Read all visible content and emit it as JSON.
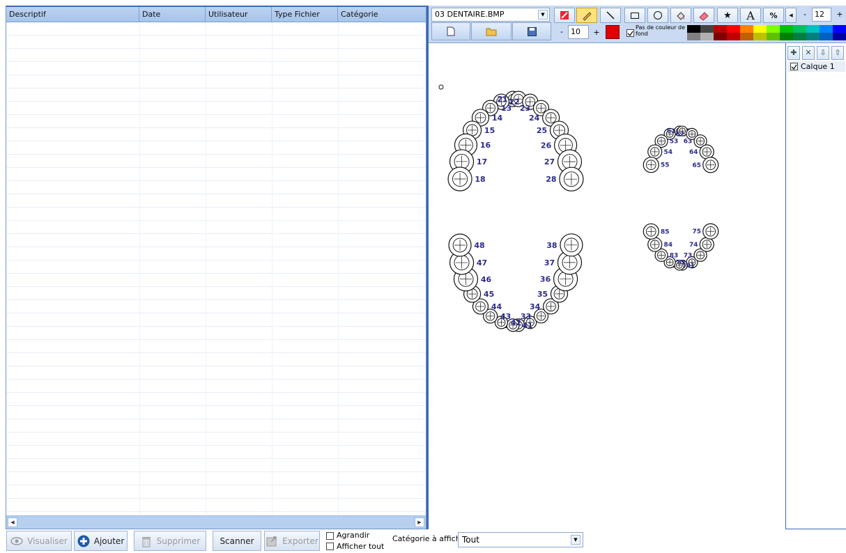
{
  "table": {
    "columns": [
      "Descriptif",
      "Date",
      "Utilisateur",
      "Type Fichier",
      "Catégorie"
    ],
    "rows": []
  },
  "bottom_toolbar": {
    "visualiser": "Visualiser",
    "ajouter": "Ajouter",
    "supprimer": "Supprimer",
    "scanner": "Scanner",
    "exporter": "Exporter",
    "agrandir": "Agrandir",
    "afficher_tout": "Afficher tout",
    "categorie_label": "Catégorie à afficher:",
    "categorie_value": "Tout"
  },
  "editor": {
    "file_name": "03 DENTAIRE.BMP",
    "pen_size": "10",
    "font_size": "12",
    "no_fill_label": "Pas de couleur de fond",
    "current_color": "#e00000",
    "palette": [
      "#000000",
      "#444444",
      "#c00000",
      "#ff0000",
      "#ff8000",
      "#ffff00",
      "#80ff00",
      "#00c000",
      "#00c060",
      "#00c0c0",
      "#0080ff",
      "#0000ff",
      "#808080",
      "#b0b0b0",
      "#800000",
      "#c00000",
      "#c06000",
      "#c0c000",
      "#60c000",
      "#008000",
      "#008040",
      "#008080",
      "#0060c0",
      "#0000a0"
    ],
    "tools": [
      "eraser-fill-icon",
      "pencil-icon",
      "line-icon",
      "rectangle-icon",
      "ellipse-icon",
      "fill-bucket-icon",
      "eraser-icon",
      "star-icon",
      "text-icon",
      "percent-icon"
    ],
    "layer": "Calque 1"
  },
  "chart_data": {
    "type": "table",
    "dental_chart": {
      "permanent_upper": [
        "11",
        "12",
        "13",
        "14",
        "15",
        "16",
        "17",
        "18",
        "21",
        "22",
        "23",
        "24",
        "25",
        "26",
        "27",
        "28"
      ],
      "permanent_lower": [
        "31",
        "32",
        "33",
        "34",
        "35",
        "36",
        "37",
        "38",
        "41",
        "42",
        "43",
        "44",
        "45",
        "46",
        "47",
        "48"
      ],
      "deciduous_upper": [
        "51",
        "52",
        "53",
        "54",
        "55",
        "61",
        "62",
        "63",
        "64",
        "65"
      ],
      "deciduous_lower": [
        "71",
        "72",
        "73",
        "74",
        "75",
        "81",
        "82",
        "83",
        "84",
        "85"
      ]
    }
  }
}
